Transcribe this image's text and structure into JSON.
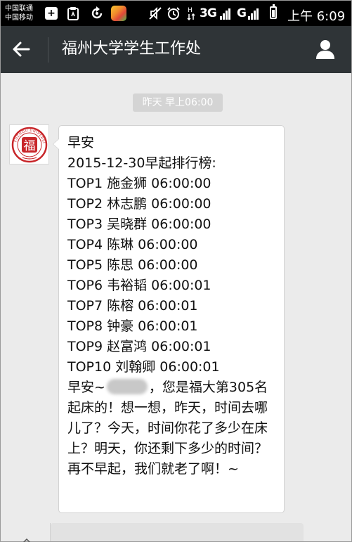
{
  "status_bar": {
    "carrier_1": "中国联通",
    "carrier_2": "中国移动",
    "network_1": "3G",
    "network_2": "G",
    "time": "上午 6:09"
  },
  "header": {
    "title": "福州大学学生工作处"
  },
  "chat": {
    "timestamp": "昨天 早上06:00",
    "message": {
      "greeting": "早安",
      "list_title": "2015-12-30早起排行榜:",
      "ranking": [
        "TOP1 施金狮 06:00:00",
        "TOP2 林志鹏 06:00:00",
        "TOP3 吴晓群 06:00:00",
        "TOP4 陈琳 06:00:00",
        "TOP5 陈思 06:00:00",
        "TOP6 韦裕韬 06:00:01",
        "TOP7 陈榕 06:00:01",
        "TOP8 钟豪 06:00:01",
        "TOP9 赵富鸿 06:00:01",
        "TOP10 刘翰卿 06:00:01"
      ],
      "closing_prefix": "早安~",
      "closing_text": "，您是福大第305名起床的！想一想，昨天，时间去哪儿了？今天，时间你花了多少在床上？明天，你还剩下多少的时间？再不早起，我们就老了啊！~"
    }
  },
  "colors": {
    "header_bg": "#2f3437",
    "chat_bg": "#ebebeb",
    "bubble_bg": "#ffffff",
    "seal_red": "#c8262a"
  }
}
